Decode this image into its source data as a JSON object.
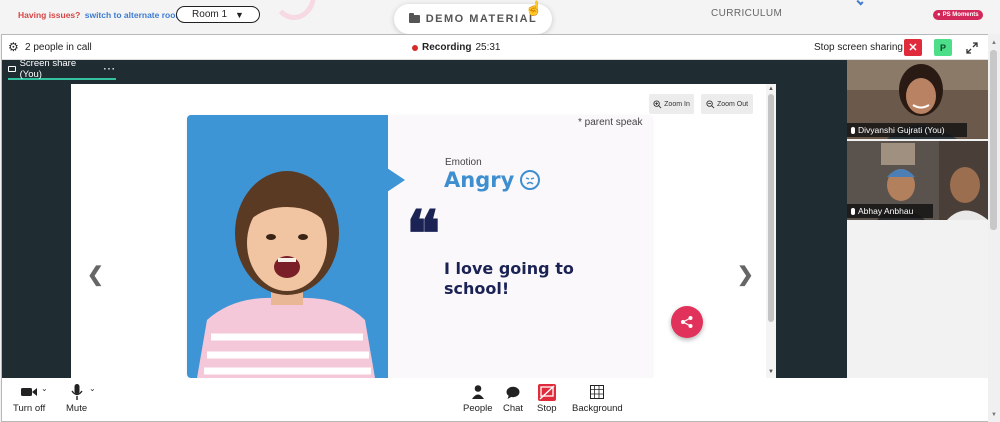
{
  "topbar": {
    "issues_question": "Having issues?",
    "issues_link": "switch to alternate room",
    "room_select": "Room 1",
    "demo_material": "DEMO MATERIAL",
    "curriculum": "CURRICULUM",
    "ps_moments": "PS Moments"
  },
  "call": {
    "people_in_call": "2 people in call",
    "recording_label": "Recording",
    "recording_time": "25:31",
    "stop_screen_sharing": "Stop screen sharing",
    "close_label": "✕",
    "p_label": "P"
  },
  "stage": {
    "tab_label": "Screen share (You)",
    "tab_more": "···",
    "zoom_in": "Zoom In",
    "zoom_out": "Zoom Out"
  },
  "slide": {
    "note": "* parent speak",
    "emotion_label": "Emotion",
    "emotion_word": "Angry",
    "quote_mark": "❝",
    "quote_text": "I love going to school!"
  },
  "participants": [
    {
      "name": "Divyanshi Gujrati (You)"
    },
    {
      "name": "Abhay Anbhau"
    }
  ],
  "controls": {
    "turn_off": "Turn off",
    "mute": "Mute",
    "people": "People",
    "chat": "Chat",
    "stop": "Stop",
    "background": "Background"
  },
  "colors": {
    "accent_teal": "#33c1a0",
    "recording_red": "#d62b2b",
    "slide_blue": "#3e95d6",
    "quote_navy": "#1b2354",
    "share_pink": "#e0325a",
    "close_red": "#e02b3c",
    "p_green": "#4dde8a"
  }
}
